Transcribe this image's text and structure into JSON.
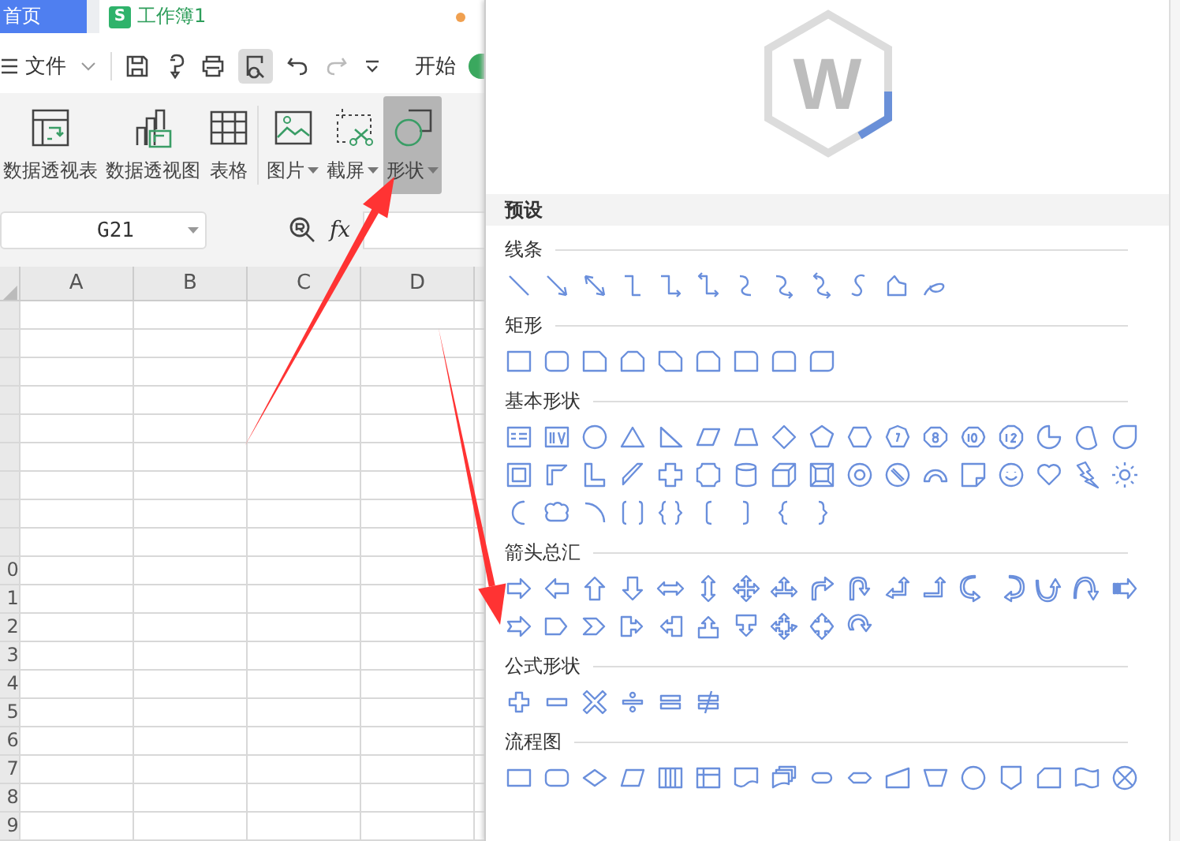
{
  "tabs": [
    {
      "label": "首页",
      "selected": false,
      "kind": "home"
    },
    {
      "label": "工作簿1",
      "selected": true,
      "kind": "sheet",
      "icon_text": "S",
      "unsaved": true
    }
  ],
  "menu_bar": {
    "label": "文件",
    "tab": "开始"
  },
  "ribbon": [
    {
      "label": "数据透视表",
      "kind": "pivot-table",
      "dropdown": false,
      "selected": false
    },
    {
      "label": "数据透视图",
      "kind": "pivot-chart",
      "dropdown": false,
      "selected": false
    },
    {
      "label": "表格",
      "kind": "table",
      "dropdown": false,
      "selected": false
    },
    {
      "label": "图片",
      "kind": "picture",
      "dropdown": true,
      "selected": false
    },
    {
      "label": "截屏",
      "kind": "screenshot",
      "dropdown": true,
      "selected": false
    },
    {
      "label": "形状",
      "kind": "shapes",
      "dropdown": true,
      "selected": true
    }
  ],
  "formula_bar": {
    "cell_ref": "G21",
    "fx": "fx"
  },
  "sheet": {
    "columns": [
      "A",
      "B",
      "C",
      "D"
    ],
    "row_labels": [
      "0",
      "1",
      "2",
      "3",
      "4",
      "5",
      "6",
      "7",
      "8",
      "9"
    ]
  },
  "shape_panel": {
    "logo_mark": "W",
    "header": "预设",
    "sections": [
      {
        "title": "线条",
        "kind": "lines"
      },
      {
        "title": "矩形",
        "kind": "rects"
      },
      {
        "title": "基本形状",
        "kind": "basic"
      },
      {
        "title": "箭头总汇",
        "kind": "arrows"
      },
      {
        "title": "公式形状",
        "kind": "formula"
      },
      {
        "title": "流程图",
        "kind": "flowchart"
      }
    ]
  }
}
